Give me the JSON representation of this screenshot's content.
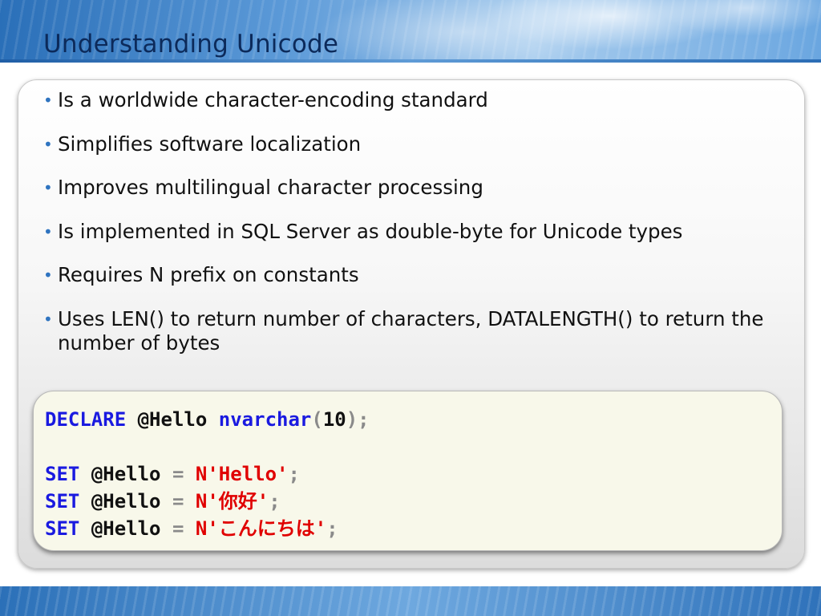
{
  "slide": {
    "title": "Understanding Unicode",
    "bullets": [
      "Is a worldwide character-encoding standard",
      "Simplifies software localization",
      "Improves multilingual character processing",
      "Is implemented in SQL Server as double-byte for Unicode types",
      "Requires N prefix on constants",
      "Uses LEN() to return number of characters, DATALENGTH() to return the number of bytes"
    ],
    "bullet_glyph": "•"
  },
  "code": {
    "line1": {
      "kw1": "DECLARE",
      "var": "@Hello",
      "kw2": "nvarchar",
      "open": "(",
      "num": "10",
      "close": ");"
    },
    "line3": {
      "kw": "SET",
      "var": "@Hello",
      "op": "=",
      "str": "N'Hello'",
      "end": ";"
    },
    "line4": {
      "kw": "SET",
      "var": "@Hello",
      "op": "=",
      "str": "N'你好'",
      "end": ";"
    },
    "line5": {
      "kw": "SET",
      "var": "@Hello",
      "op": "=",
      "str": "N'こんにちは'",
      "end": ";"
    }
  },
  "colors": {
    "keyword": "#1a1ae0",
    "string": "#e00000",
    "operator": "#8a8a8a",
    "title": "#0c2a5a",
    "bullet": "#2f74c0"
  }
}
